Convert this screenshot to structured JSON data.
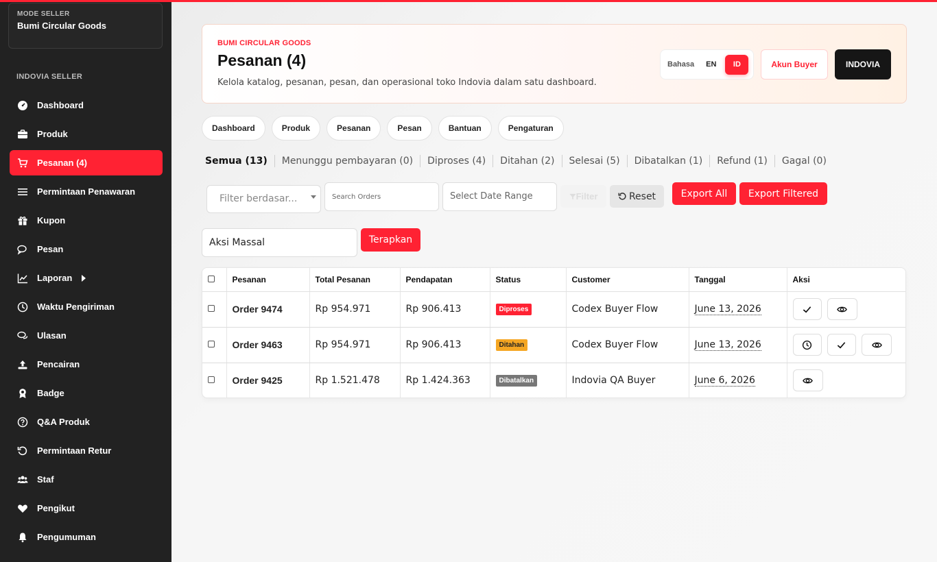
{
  "sidebar": {
    "mode_label": "MODE SELLER",
    "store_name": "Bumi Circular Goods",
    "section_title": "INDOVIA SELLER",
    "items": [
      {
        "label": "Dashboard",
        "icon": "dashboard-icon"
      },
      {
        "label": "Produk",
        "icon": "briefcase-icon"
      },
      {
        "label": "Pesanan (4)",
        "icon": "cart-icon",
        "active": true
      },
      {
        "label": "Permintaan Penawaran",
        "icon": "list-icon"
      },
      {
        "label": "Kupon",
        "icon": "gift-icon"
      },
      {
        "label": "Pesan",
        "icon": "chat-icon"
      },
      {
        "label": "Laporan",
        "icon": "chart-line-icon",
        "has_submenu": true
      },
      {
        "label": "Waktu Pengiriman",
        "icon": "clock-icon"
      },
      {
        "label": "Ulasan",
        "icon": "comments-icon"
      },
      {
        "label": "Pencairan",
        "icon": "upload-icon"
      },
      {
        "label": "Badge",
        "icon": "award-icon"
      },
      {
        "label": "Q&A Produk",
        "icon": "question-icon"
      },
      {
        "label": "Permintaan Retur",
        "icon": "undo-icon"
      },
      {
        "label": "Staf",
        "icon": "users-icon"
      },
      {
        "label": "Pengikut",
        "icon": "heart-icon"
      },
      {
        "label": "Pengumuman",
        "icon": "bell-icon"
      }
    ]
  },
  "header": {
    "brand": "BUMI CIRCULAR GOODS",
    "title": "Pesanan (4)",
    "description": "Kelola katalog, pesanan, pesan, dan operasional toko Indovia dalam satu dashboard.",
    "language_label": "Bahasa",
    "lang_en": "EN",
    "lang_id": "ID",
    "buyer_button": "Akun Buyer",
    "indovia_button": "INDOVIA"
  },
  "quick_nav": [
    "Dashboard",
    "Produk",
    "Pesanan",
    "Pesan",
    "Bantuan",
    "Pengaturan"
  ],
  "status_tabs": [
    "Semua (13)",
    "Menunggu pembayaran (0)",
    "Diproses (4)",
    "Ditahan (2)",
    "Selesai (5)",
    "Dibatalkan (1)",
    "Refund (1)",
    "Gagal (0)"
  ],
  "filters": {
    "filter_by_placeholder": "Filter berdasar...",
    "search_placeholder": "Search Orders",
    "date_placeholder": "Select Date Range",
    "filter_label": "Filter",
    "reset_label": "Reset",
    "export_all": "Export All",
    "export_filtered": "Export Filtered"
  },
  "bulk": {
    "selected": "Aksi Massal",
    "apply": "Terapkan"
  },
  "table": {
    "columns": [
      "Pesanan",
      "Total Pesanan",
      "Pendapatan",
      "Status",
      "Customer",
      "Tanggal",
      "Aksi"
    ],
    "rows": [
      {
        "order": "Order 9474",
        "total": "Rp 954.971",
        "income": "Rp 906.413",
        "status": "Diproses",
        "customer": "Codex Buyer Flow",
        "date": "June 13, 2026"
      },
      {
        "order": "Order 9463",
        "total": "Rp 954.971",
        "income": "Rp 906.413",
        "status": "Ditahan",
        "customer": "Codex Buyer Flow",
        "date": "June 13, 2026"
      },
      {
        "order": "Order 9425",
        "total": "Rp 1.521.478",
        "income": "Rp 1.424.363",
        "status": "Dibatalkan",
        "customer": "Indovia QA Buyer",
        "date": "June 6, 2026"
      }
    ]
  },
  "colors": {
    "accent": "#ff2233",
    "sidebar_bg": "#222222",
    "status_diproses": "#ff2233",
    "status_ditahan": "#f5a623",
    "status_dibatalkan": "#777777"
  }
}
